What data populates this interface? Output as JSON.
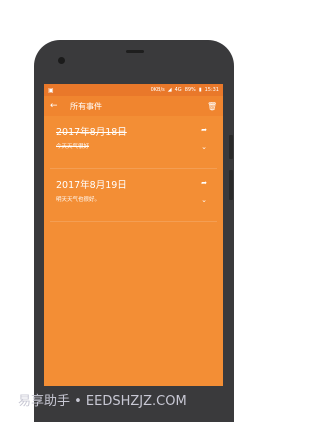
{
  "status_bar": {
    "net_speed": "0KB/s",
    "signal": "4G",
    "battery": "89%",
    "time": "15:31"
  },
  "toolbar": {
    "title": "所有事件",
    "back_icon": "arrow-left-icon",
    "delete_icon": "trash-icon"
  },
  "events": [
    {
      "date": "2017年8月18日",
      "content": "今天天气很好",
      "completed": true
    },
    {
      "date": "2017年8月19日",
      "content": "明天天气也很好。",
      "completed": false
    }
  ],
  "watermark": "易享助手 • EEDSHZJZ.COM",
  "colors": {
    "accent": "#f38e35",
    "toolbar": "#f0852f",
    "statusbar": "#e9782a"
  }
}
